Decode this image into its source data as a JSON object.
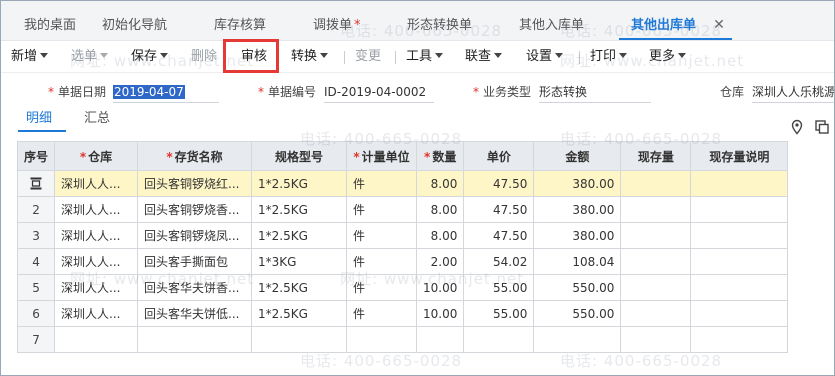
{
  "tabs": [
    {
      "label": "我的桌面",
      "active": false
    },
    {
      "label": "初始化导航",
      "active": false
    },
    {
      "label": "库存核算",
      "active": false
    },
    {
      "label": "调拨单",
      "active": false,
      "modified": true
    },
    {
      "label": "形态转换单",
      "active": false
    },
    {
      "label": "其他入库单",
      "active": false
    },
    {
      "label": "其他出库单",
      "active": true
    }
  ],
  "tab_modified_marker": "*",
  "tab_close_glyph": "✕",
  "toolbar": {
    "new": "新增",
    "select_doc": "选单",
    "save": "保存",
    "delete": "删除",
    "audit": "审核",
    "convert": "转换",
    "change": "变更",
    "tools": "工具",
    "linked_query": "联查",
    "settings": "设置",
    "print": "打印",
    "more": "更多"
  },
  "form": {
    "date_label": "单据日期",
    "date_value": "2019-04-07",
    "code_label": "单据编号",
    "code_value": "ID-2019-04-0002",
    "biztype_label": "业务类型",
    "biztype_value": "形态转换",
    "warehouse_label": "仓库",
    "warehouse_value": "深圳人人乐桃源"
  },
  "subtabs": {
    "detail": "明细",
    "summary": "汇总"
  },
  "icons": {
    "location": "location-pin-icon",
    "copy": "copy-icon",
    "row_edit": "row-edit-icon"
  },
  "grid": {
    "headers": {
      "idx": "序号",
      "warehouse": "仓库",
      "item": "存货名称",
      "spec": "规格型号",
      "unit": "计量单位",
      "qty": "数量",
      "price": "单价",
      "amount": "金额",
      "stock": "现存量",
      "stock_note": "现存量说明"
    },
    "required_marker": "*",
    "rows": [
      {
        "idx": "",
        "warehouse": "深圳人人...",
        "item": "回头客铜锣烧红...",
        "spec": "1*2.5KG",
        "unit": "件",
        "qty": "8.00",
        "price": "47.50",
        "amount": "380.00",
        "stock": "",
        "stock_note": ""
      },
      {
        "idx": "2",
        "warehouse": "深圳人人...",
        "item": "回头客铜锣烧香...",
        "spec": "1*2.5KG",
        "unit": "件",
        "qty": "8.00",
        "price": "47.50",
        "amount": "380.00",
        "stock": "",
        "stock_note": ""
      },
      {
        "idx": "3",
        "warehouse": "深圳人人...",
        "item": "回头客铜锣烧凤...",
        "spec": "1*2.5KG",
        "unit": "件",
        "qty": "8.00",
        "price": "47.50",
        "amount": "380.00",
        "stock": "",
        "stock_note": ""
      },
      {
        "idx": "4",
        "warehouse": "深圳人人...",
        "item": "回头客手撕面包",
        "spec": "1*3KG",
        "unit": "件",
        "qty": "2.00",
        "price": "54.02",
        "amount": "108.04",
        "stock": "",
        "stock_note": ""
      },
      {
        "idx": "5",
        "warehouse": "深圳人人...",
        "item": "回头客华夫饼香...",
        "spec": "1*2.5KG",
        "unit": "件",
        "qty": "10.00",
        "price": "55.00",
        "amount": "550.00",
        "stock": "",
        "stock_note": ""
      },
      {
        "idx": "6",
        "warehouse": "深圳人人...",
        "item": "回头客华夫饼低...",
        "spec": "1*2.5KG",
        "unit": "件",
        "qty": "10.00",
        "price": "55.00",
        "amount": "550.00",
        "stock": "",
        "stock_note": ""
      },
      {
        "idx": "7",
        "warehouse": "",
        "item": "",
        "spec": "",
        "unit": "",
        "qty": "",
        "price": "",
        "amount": "",
        "stock": "",
        "stock_note": ""
      }
    ]
  },
  "watermark": {
    "phone": "电话: 400-665-0028",
    "site": "网址: www.chanjet.net"
  },
  "colors": {
    "accent": "#1e78d8",
    "highlight_box": "#e53935",
    "selected_row": "#fff6c8",
    "required": "#e0332b"
  }
}
